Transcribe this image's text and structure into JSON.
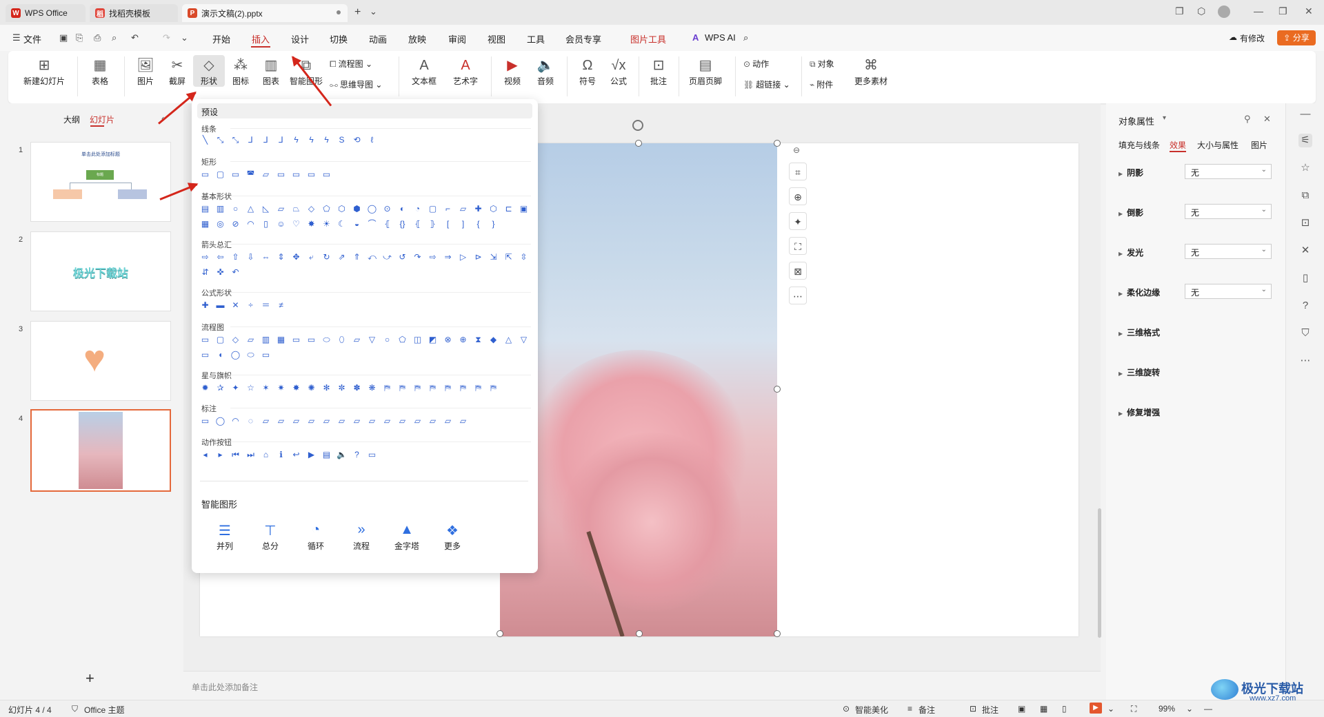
{
  "titlebar": {
    "tabs": [
      {
        "label": "WPS Office",
        "icon": "wps-logo-icon"
      },
      {
        "label": "找稻壳模板",
        "icon": "docer-icon"
      },
      {
        "label": "演示文稿(2).pptx",
        "icon": "ppt-icon"
      }
    ],
    "new_tab": "+",
    "more": "⌄"
  },
  "menubar": {
    "file": "文件",
    "items": [
      "开始",
      "插入",
      "设计",
      "切换",
      "动画",
      "放映",
      "审阅",
      "视图",
      "工具",
      "会员专享"
    ],
    "picture_tools": "图片工具",
    "wps_ai": "WPS AI",
    "changes": "有修改",
    "share": "分享"
  },
  "ribbon": {
    "new_slide": "新建幻灯片",
    "table": "表格",
    "picture": "图片",
    "screenshot": "截屏",
    "shape": "形状",
    "icon": "图标",
    "chart": "图表",
    "smart_art": "智能图形",
    "flowchart": "流程图",
    "mindmap": "思维导图",
    "textbox": "文本框",
    "wordart": "艺术字",
    "video": "视频",
    "audio": "音频",
    "symbol": "符号",
    "formula": "公式",
    "comment": "批注",
    "header_footer": "页眉页脚",
    "action": "动作",
    "hyperlink": "超链接",
    "object": "对象",
    "attachment": "附件",
    "more_material": "更多素材"
  },
  "leftpanel": {
    "outline": "大纲",
    "slides": "幻灯片",
    "add": "+",
    "thumbs": [
      {
        "num": "1",
        "title": "单击此处添加标题",
        "node": "标题"
      },
      {
        "num": "2",
        "text": "极光下载站"
      },
      {
        "num": "3"
      },
      {
        "num": "4"
      }
    ]
  },
  "dropdown": {
    "preset": "预设",
    "sections": [
      {
        "name": "线条"
      },
      {
        "name": "矩形"
      },
      {
        "name": "基本形状"
      },
      {
        "name": "箭头总汇"
      },
      {
        "name": "公式形状"
      },
      {
        "name": "流程图"
      },
      {
        "name": "星与旗帜"
      },
      {
        "name": "标注"
      },
      {
        "name": "动作按钮"
      }
    ],
    "smart_title": "智能图形",
    "smart_items": [
      "并列",
      "总分",
      "循环",
      "流程",
      "金字塔",
      "更多"
    ]
  },
  "notes": {
    "placeholder": "单击此处添加备注"
  },
  "rightpanel": {
    "title": "对象属性",
    "tabs": [
      "填充与线条",
      "效果",
      "大小与属性",
      "图片"
    ],
    "rows": [
      {
        "label": "阴影",
        "value": "无"
      },
      {
        "label": "倒影",
        "value": "无"
      },
      {
        "label": "发光",
        "value": "无"
      },
      {
        "label": "柔化边缘",
        "value": "无"
      },
      {
        "label": "三维格式"
      },
      {
        "label": "三维旋转"
      },
      {
        "label": "修复增强"
      }
    ]
  },
  "statusbar": {
    "slide_info": "幻灯片 4 / 4",
    "theme": "Office 主题",
    "smart_beautify": "智能美化",
    "notes": "备注",
    "comments": "批注",
    "zoom": "99%"
  },
  "watermark": {
    "text": "极光下载站",
    "url": "www.xz7.com"
  },
  "colors": {
    "accent": "#c8302b",
    "selection": "#e4683a",
    "shape_blue": "#2f5fcf",
    "arrow_red": "#d4261b"
  }
}
